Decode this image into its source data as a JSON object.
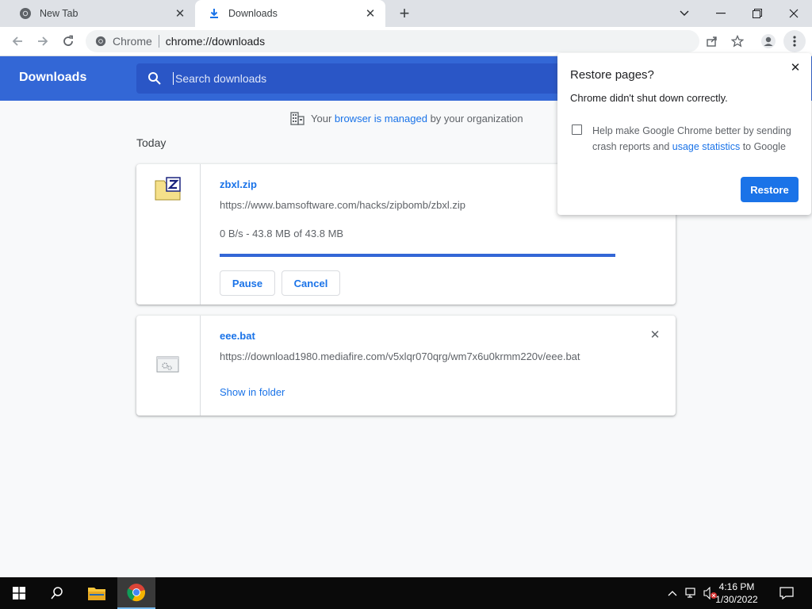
{
  "tabs": [
    {
      "title": "New Tab",
      "icon": "chrome-logo-icon",
      "active": false
    },
    {
      "title": "Downloads",
      "icon": "download-icon",
      "active": true
    }
  ],
  "toolbar": {
    "site_label": "Chrome",
    "url": "chrome://downloads"
  },
  "page": {
    "title": "Downloads",
    "search_placeholder": "Search downloads"
  },
  "managed_notice": {
    "before": "Your ",
    "link": "browser is managed",
    "after": " by your organization"
  },
  "date_heading": "Today",
  "downloads": [
    {
      "file_name": "zbxl.zip",
      "url": "https://www.bamsoftware.com/hacks/zipbomb/zbxl.zip",
      "status": "0 B/s - 43.8 MB of 43.8 MB",
      "progress": 1.0,
      "pause_label": "Pause",
      "cancel_label": "Cancel",
      "icon": "zip-file-icon"
    },
    {
      "file_name": "eee.bat",
      "url": "https://download1980.mediafire.com/v5xlqr070qrg/wm7x6u0krmm220v/eee.bat",
      "show_in_folder": "Show in folder",
      "icon": "batch-file-icon"
    }
  ],
  "restore_bubble": {
    "title": "Restore pages?",
    "message": "Chrome didn't shut down correctly.",
    "checkbox_before": "Help make Google Chrome better by sending crash reports and ",
    "checkbox_link": "usage statistics",
    "checkbox_after": " to Google",
    "checked": false,
    "button": "Restore"
  },
  "taskbar": {
    "time": "4:16 PM",
    "date": "1/30/2022"
  },
  "colors": {
    "header_blue": "#3367d6",
    "link_blue": "#1a73e8",
    "search_bg": "#2a56c6"
  }
}
